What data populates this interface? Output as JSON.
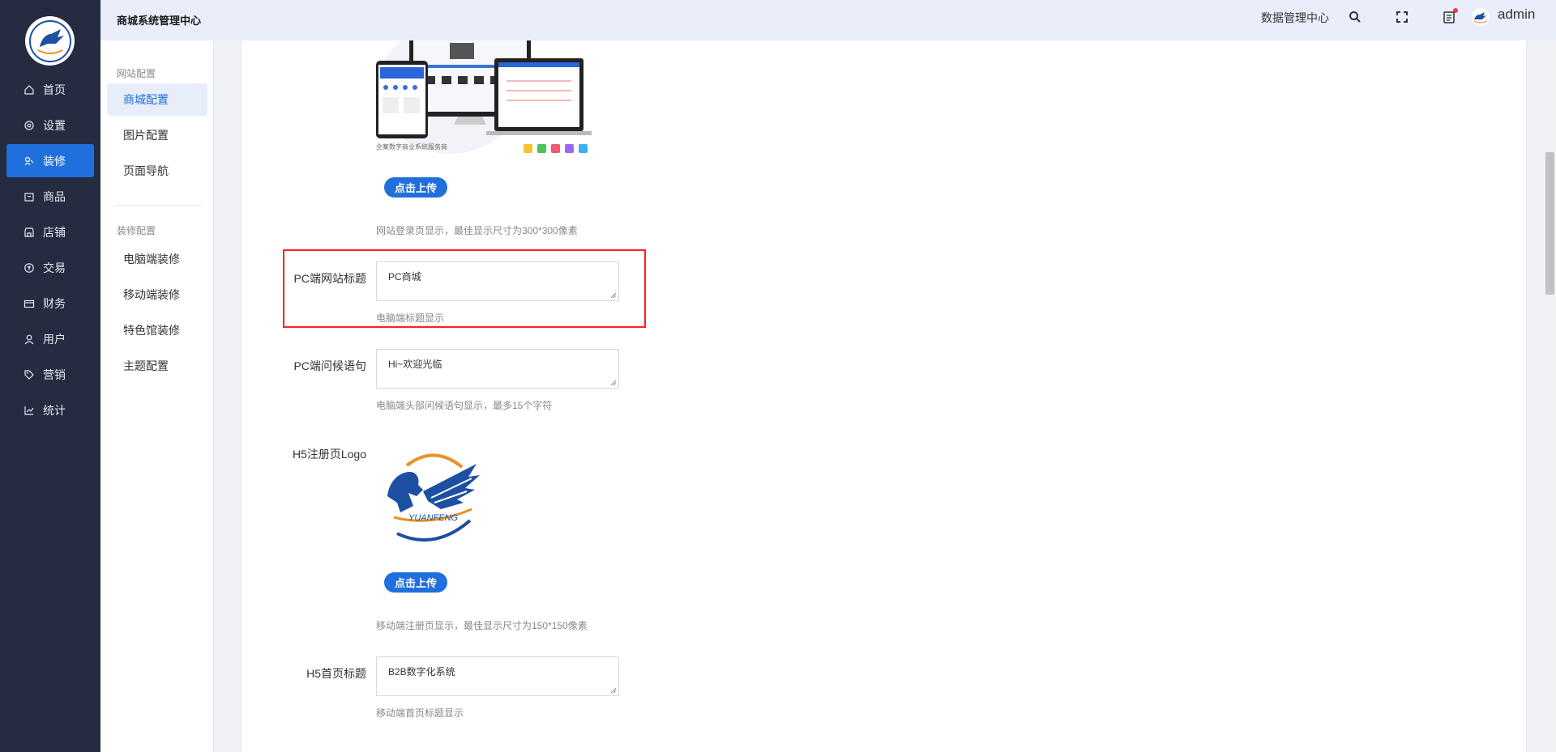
{
  "header": {
    "title": "商城系统管理中心",
    "data_center": "数据管理中心",
    "username": "admin"
  },
  "leftnav": {
    "items": [
      {
        "label": "首页",
        "icon": "home-icon"
      },
      {
        "label": "设置",
        "icon": "gear-icon"
      },
      {
        "label": "装修",
        "icon": "decorate-icon"
      },
      {
        "label": "商品",
        "icon": "goods-icon"
      },
      {
        "label": "店铺",
        "icon": "shop-icon"
      },
      {
        "label": "交易",
        "icon": "trade-icon"
      },
      {
        "label": "财务",
        "icon": "finance-icon"
      },
      {
        "label": "用户",
        "icon": "user-icon"
      },
      {
        "label": "营销",
        "icon": "tag-icon"
      },
      {
        "label": "统计",
        "icon": "chart-icon"
      }
    ],
    "active_index": 2
  },
  "submenu": {
    "group1": "网站配置",
    "group1_items": [
      "商城配置",
      "图片配置",
      "页面导航"
    ],
    "group2": "装修配置",
    "group2_items": [
      "电脑端装修",
      "移动端装修",
      "特色馆装修",
      "主题配置"
    ]
  },
  "form": {
    "login_logo_caption": "全案数字商业系统服务商",
    "upload_label": "点击上传",
    "login_logo_tip": "网站登录页显示，最佳显示尺寸为300*300像素",
    "pc_title_label": "PC端网站标题",
    "pc_title_value": "PC商城",
    "pc_title_tip": "电脑端标题显示",
    "pc_greeting_label": "PC端问候语句",
    "pc_greeting_value": "Hi~欢迎光临",
    "pc_greeting_tip": "电脑端头部问候语句显示，最多15个字符",
    "h5_logo_label": "H5注册页Logo",
    "h5_logo_brand": "YUANFENG",
    "h5_logo_tip": "移动端注册页显示，最佳显示尺寸为150*150像素",
    "h5_title_label": "H5首页标题",
    "h5_title_value": "B2B数字化系统",
    "h5_title_tip": "移动端首页标题显示"
  },
  "colors": {
    "nav_bg": "#252b40",
    "accent": "#1f6fdc",
    "highlight": "#ff1f1f"
  }
}
